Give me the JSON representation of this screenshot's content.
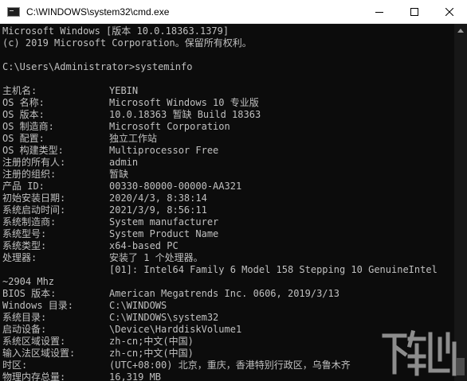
{
  "window": {
    "title": "C:\\WINDOWS\\system32\\cmd.exe",
    "controls": {
      "minimize": "minimize",
      "maximize": "maximize",
      "close": "close"
    }
  },
  "console": {
    "header_lines": [
      "Microsoft Windows [版本 10.0.18363.1379]",
      "(c) 2019 Microsoft Corporation。保留所有权利。",
      "",
      "C:\\Users\\Administrator>systeminfo"
    ],
    "rows": [
      {
        "key": "主机名:",
        "value": "YEBIN"
      },
      {
        "key": "OS 名称:",
        "value": "Microsoft Windows 10 专业版"
      },
      {
        "key": "OS 版本:",
        "value": "10.0.18363 暂缺 Build 18363"
      },
      {
        "key": "OS 制造商:",
        "value": "Microsoft Corporation"
      },
      {
        "key": "OS 配置:",
        "value": "独立工作站"
      },
      {
        "key": "OS 构建类型:",
        "value": "Multiprocessor Free"
      },
      {
        "key": "注册的所有人:",
        "value": "admin"
      },
      {
        "key": "注册的组织:",
        "value": "暂缺"
      },
      {
        "key": "产品 ID:",
        "value": "00330-80000-00000-AA321"
      },
      {
        "key": "初始安装日期:",
        "value": "2020/4/3, 8:38:14"
      },
      {
        "key": "系统启动时间:",
        "value": "2021/3/9, 8:56:11"
      },
      {
        "key": "系统制造商:",
        "value": "System manufacturer"
      },
      {
        "key": "系统型号:",
        "value": "System Product Name"
      },
      {
        "key": "系统类型:",
        "value": "x64-based PC"
      },
      {
        "key": "处理器:",
        "value": "安装了 1 个处理器。"
      },
      {
        "key": "",
        "value": "[01]: Intel64 Family 6 Model 158 Stepping 10 GenuineIntel"
      },
      {
        "key": "~2904 Mhz",
        "value": ""
      },
      {
        "key": "BIOS 版本:",
        "value": "American Megatrends Inc. 0606, 2019/3/13"
      },
      {
        "key": "Windows 目录:",
        "value": "C:\\WINDOWS"
      },
      {
        "key": "系统目录:",
        "value": "C:\\WINDOWS\\system32"
      },
      {
        "key": "启动设备:",
        "value": "\\Device\\HarddiskVolume1"
      },
      {
        "key": "系统区域设置:",
        "value": "zh-cn;中文(中国)"
      },
      {
        "key": "输入法区域设置:",
        "value": "zh-cn;中文(中国)"
      },
      {
        "key": "时区:",
        "value": "(UTC+08:00) 北京，重庆，香港特别行政区，乌鲁木齐"
      },
      {
        "key": "物理内存总量:",
        "value": "16,319 MB"
      }
    ]
  },
  "watermark": {
    "text": "下载吧"
  },
  "colors": {
    "console_bg": "#0c0c0c",
    "console_text": "#c0c0c0",
    "titlebar_bg": "#ffffff"
  }
}
